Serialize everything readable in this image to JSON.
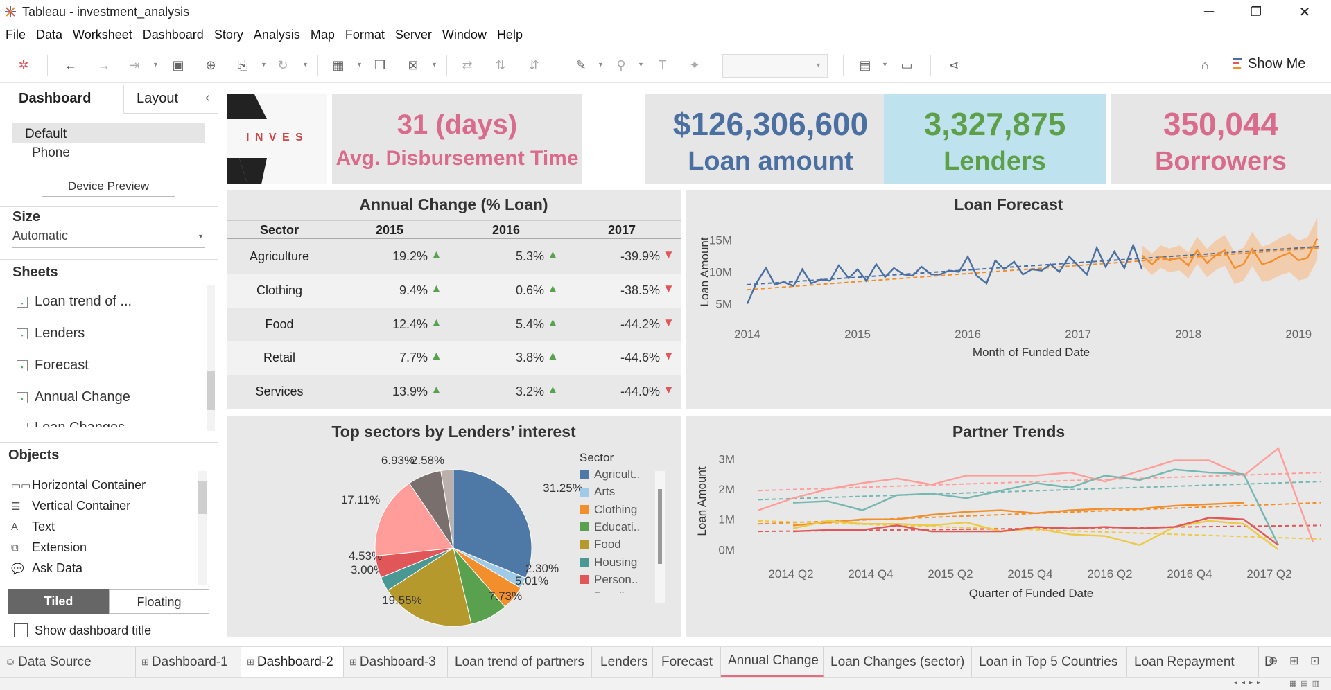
{
  "window": {
    "title": "Tableau - investment_analysis",
    "minimize": "─",
    "maximize": "❐",
    "close": "✕"
  },
  "menu": [
    "File",
    "Data",
    "Worksheet",
    "Dashboard",
    "Story",
    "Analysis",
    "Map",
    "Format",
    "Server",
    "Window",
    "Help"
  ],
  "toolbar": {
    "show_me": "Show Me"
  },
  "sidebar": {
    "tabs": {
      "dashboard": "Dashboard",
      "layout": "Layout",
      "collapse": "‹"
    },
    "devices": {
      "default": "Default",
      "phone": "Phone",
      "preview_button": "Device Preview"
    },
    "size": {
      "header": "Size",
      "value": "Automatic"
    },
    "sheets": {
      "header": "Sheets",
      "items": [
        "Loan trend of ...",
        "Lenders",
        "Forecast",
        "Annual Change",
        "Loan Changes"
      ]
    },
    "objects": {
      "header": "Objects",
      "items": [
        "Horizontal Container",
        "Vertical Container",
        "Text",
        "Extension",
        "Ask Data"
      ]
    },
    "layout_mode": {
      "tiled": "Tiled",
      "floating": "Floating"
    },
    "show_title": "Show dashboard title"
  },
  "logo_text": "I N V E S",
  "kpis": {
    "disb": {
      "value": "31 (days)",
      "label": "Avg. Disbursement Time",
      "color": "#d96b8c"
    },
    "loan": {
      "value": "$126,306,600",
      "label": "Loan amount",
      "color": "#4a6fa0"
    },
    "lenders": {
      "value": "3,327,875",
      "label": "Lenders",
      "color": "#5ea04a"
    },
    "borrowers": {
      "value": "350,044",
      "label": "Borrowers",
      "color": "#d96b8c"
    }
  },
  "annual": {
    "title": "Annual Change (% Loan)",
    "headers": [
      "Sector",
      "2015",
      "2016",
      "2017"
    ],
    "rows": [
      {
        "sector": "Agriculture",
        "v": [
          "19.2%",
          "5.3%",
          "-39.9%"
        ],
        "up": [
          true,
          true,
          false
        ]
      },
      {
        "sector": "Clothing",
        "v": [
          "9.4%",
          "0.6%",
          "-38.5%"
        ],
        "up": [
          true,
          true,
          false
        ]
      },
      {
        "sector": "Food",
        "v": [
          "12.4%",
          "5.4%",
          "-44.2%"
        ],
        "up": [
          true,
          true,
          false
        ]
      },
      {
        "sector": "Retail",
        "v": [
          "7.7%",
          "3.8%",
          "-44.6%"
        ],
        "up": [
          true,
          true,
          false
        ]
      },
      {
        "sector": "Services",
        "v": [
          "13.9%",
          "3.2%",
          "-44.0%"
        ],
        "up": [
          true,
          true,
          false
        ]
      }
    ]
  },
  "chart_data": [
    {
      "type": "line",
      "title": "Loan Forecast",
      "xlabel": "Month of Funded Date",
      "ylabel": "Loan Amount",
      "x_ticks": [
        "2014",
        "2015",
        "2016",
        "2017",
        "2018",
        "2019"
      ],
      "y_ticks": [
        "5M",
        "10M",
        "15M"
      ],
      "ylim": [
        2,
        18
      ],
      "xlim": [
        2013.95,
        2019.2
      ],
      "series": [
        {
          "color": "#4a6fa0",
          "x": [
            2014.0,
            2014.08,
            2014.17,
            2014.25,
            2014.33,
            2014.42,
            2014.5,
            2014.58,
            2014.67,
            2014.75,
            2014.83,
            2014.92,
            2015.0,
            2015.08,
            2015.17,
            2015.25,
            2015.33,
            2015.42,
            2015.5,
            2015.58,
            2015.67,
            2015.75,
            2015.83,
            2015.92,
            2016.0,
            2016.08,
            2016.17,
            2016.25,
            2016.33,
            2016.42,
            2016.5,
            2016.58,
            2016.67,
            2016.75,
            2016.83,
            2016.92,
            2017.0,
            2017.08,
            2017.17,
            2017.25,
            2017.33,
            2017.42,
            2017.5,
            2017.58
          ],
          "y": [
            5.0,
            8.2,
            10.6,
            8.0,
            8.4,
            7.8,
            10.4,
            8.2,
            8.8,
            8.6,
            11.0,
            9.0,
            10.4,
            8.6,
            11.2,
            9.2,
            10.6,
            9.6,
            9.4,
            10.8,
            9.6,
            9.6,
            10.2,
            10.0,
            12.4,
            9.4,
            8.2,
            11.8,
            10.4,
            11.6,
            9.6,
            10.4,
            10.2,
            11.2,
            10.0,
            12.4,
            11.0,
            9.6,
            13.8,
            10.8,
            13.2,
            10.6,
            14.2,
            10.4
          ]
        },
        {
          "color": "#f28e2b",
          "x": [
            2017.58,
            2017.67,
            2017.75,
            2017.83,
            2017.92,
            2018.0,
            2018.08,
            2018.17,
            2018.25,
            2018.33,
            2018.42,
            2018.5,
            2018.58,
            2018.67,
            2018.75,
            2018.83,
            2018.92,
            2019.0,
            2019.08,
            2019.17
          ],
          "y": [
            12.6,
            11.2,
            12.4,
            11.8,
            12.2,
            11.0,
            13.4,
            11.4,
            12.6,
            13.4,
            10.6,
            11.2,
            13.6,
            11.2,
            11.6,
            12.4,
            13.0,
            11.8,
            12.2,
            15.2
          ]
        }
      ]
    },
    {
      "type": "pie",
      "title": "Top sectors by Lenders’ interest",
      "legend_title": "Sector",
      "legend": [
        "Agricult..",
        "Arts",
        "Clothing",
        "Educati..",
        "Food",
        "Housing",
        "Person..",
        "Retail"
      ],
      "slices": [
        {
          "label": "31.25%",
          "value": 31.25,
          "color": "#4e79a7"
        },
        {
          "label": "2.30%",
          "value": 2.3,
          "color": "#a0cbe8"
        },
        {
          "label": "5.01%",
          "value": 5.01,
          "color": "#f28e2b"
        },
        {
          "label": "7.73%",
          "value": 7.73,
          "color": "#59a14f"
        },
        {
          "label": "19.55%",
          "value": 19.55,
          "color": "#b6992d"
        },
        {
          "label": "3.00%",
          "value": 3.0,
          "color": "#499894"
        },
        {
          "label": "4.53%",
          "value": 4.53,
          "color": "#e15759"
        },
        {
          "label": "17.11%",
          "value": 17.11,
          "color": "#ff9d9a"
        },
        {
          "label": "6.93%",
          "value": 6.93,
          "color": "#79706e"
        },
        {
          "label": "2.58%",
          "value": 2.58,
          "color": "#bab0ac"
        }
      ]
    },
    {
      "type": "line",
      "title": "Partner Trends",
      "xlabel": "Quarter of Funded Date",
      "ylabel": "Loan Amount",
      "x_ticks": [
        "2014 Q2",
        "2014 Q4",
        "2015 Q2",
        "2015 Q4",
        "2016 Q2",
        "2016 Q4",
        "2017 Q2"
      ],
      "y_ticks": [
        "0M",
        "1M",
        "2M",
        "3M"
      ],
      "ylim": [
        -0.2,
        3.4
      ],
      "series": [
        {
          "color": "#ff9d9a",
          "y": [
            1.3,
            1.7,
            2.0,
            2.2,
            2.35,
            2.15,
            2.45,
            2.45,
            2.45,
            2.55,
            2.25,
            2.6,
            2.95,
            2.95,
            2.45,
            3.35,
            0.25
          ]
        },
        {
          "color": "#76b7b2",
          "y": [
            1.55,
            1.6,
            1.3,
            1.8,
            1.85,
            1.7,
            1.95,
            2.2,
            2.05,
            2.45,
            2.3,
            2.65,
            2.55,
            2.5,
            0.15
          ]
        },
        {
          "color": "#f28e2b",
          "y": [
            0.8,
            0.9,
            1.0,
            1.0,
            1.15,
            1.25,
            1.3,
            1.2,
            1.3,
            1.35,
            1.35,
            1.45,
            1.5,
            1.55
          ]
        },
        {
          "color": "#edc948",
          "y": [
            0.7,
            0.95,
            0.85,
            0.85,
            0.8,
            0.9,
            0.6,
            0.7,
            0.5,
            0.45,
            0.15,
            0.75,
            0.95,
            0.85,
            0.0
          ]
        },
        {
          "color": "#e15759",
          "y": [
            0.6,
            0.65,
            0.65,
            0.8,
            0.6,
            0.6,
            0.6,
            0.75,
            0.7,
            0.75,
            0.7,
            0.75,
            1.05,
            1.0,
            0.15
          ]
        }
      ],
      "trends": [
        {
          "color": "#ff9d9a",
          "y0": 1.95,
          "y1": 2.55
        },
        {
          "color": "#76b7b2",
          "y0": 1.65,
          "y1": 2.25
        },
        {
          "color": "#f28e2b",
          "y0": 0.85,
          "y1": 1.55
        },
        {
          "color": "#edc948",
          "y0": 0.95,
          "y1": 0.35
        },
        {
          "color": "#e15759",
          "y0": 0.6,
          "y1": 0.8
        }
      ]
    }
  ],
  "sheet_tabs": [
    "Data Source",
    "Dashboard-1",
    "Dashboard-2",
    "Dashboard-3",
    "Loan trend of partners",
    "Lenders",
    "Forecast",
    "Annual Change",
    "Loan Changes (sector)",
    "Loan in Top 5 Countries",
    "Loan Repayment",
    "Dis"
  ]
}
